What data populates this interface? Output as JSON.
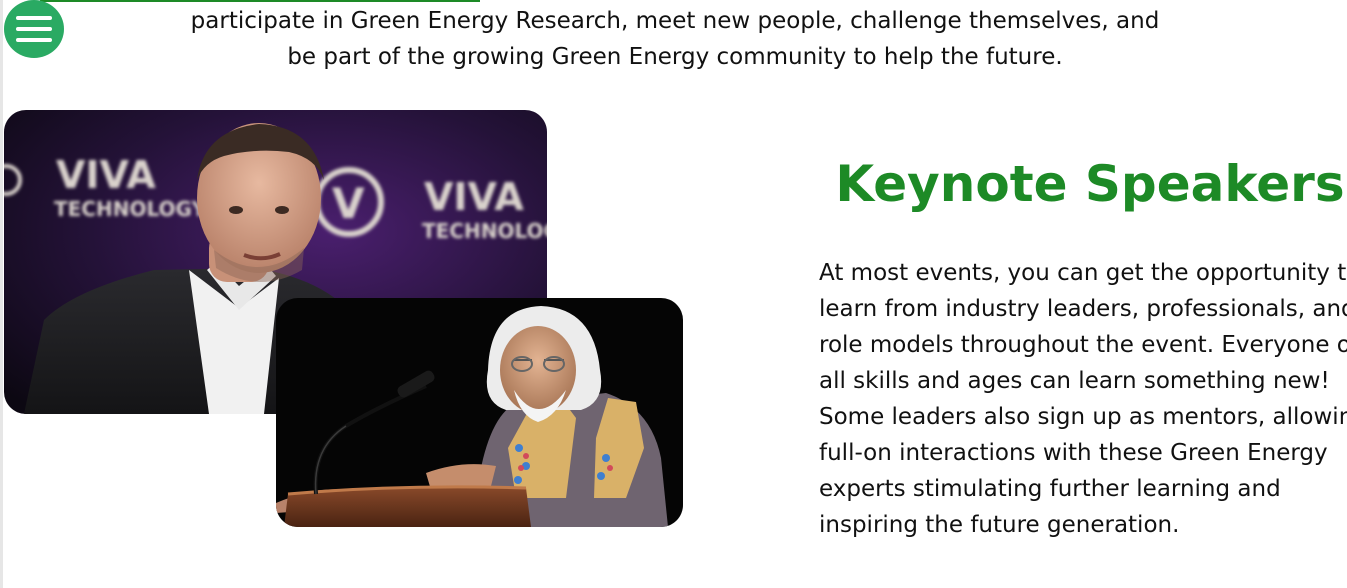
{
  "colors": {
    "accent": "#1d8a26",
    "menu_button_bg": "#2aaa63",
    "text": "#111111"
  },
  "nav": {
    "menu_icon": "hamburger-menu-icon"
  },
  "intro": {
    "line1": "participate in Green Energy Research, meet new people, challenge themselves, and",
    "line2": "be part of the growing Green Energy community to help the future."
  },
  "speakers_section": {
    "title": "Keynote Speakers",
    "body": "At most events, you can get the opportunity to learn from industry leaders, professionals, and role models throughout the event.  Everyone of all skills and ages can learn something new! Some leaders also sign up as mentors, allowing full-on interactions with these Green Energy experts stimulating further learning and inspiring the future generation.",
    "photo1_backdrop_text_a": "VIVA",
    "photo1_backdrop_text_b": "TECHNOLOGY",
    "photo1_backdrop_logo": "V"
  }
}
